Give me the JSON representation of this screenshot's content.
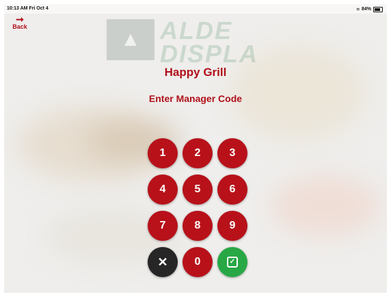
{
  "status_bar": {
    "time": "10:13 AM  Fri Oct 4",
    "battery": "84%",
    "icons": [
      "wifi-icon",
      "battery-icon"
    ]
  },
  "nav": {
    "back_label": "Back",
    "back_icon": "arrow-right-icon"
  },
  "watermark": {
    "line1": "ALDE",
    "line2": "DISPLA"
  },
  "header": {
    "title": "Happy Grill",
    "prompt": "Enter Manager Code"
  },
  "keypad": {
    "keys": [
      "1",
      "2",
      "3",
      "4",
      "5",
      "6",
      "7",
      "8",
      "9"
    ],
    "clear_icon": "close-icon",
    "clear_glyph": "✕",
    "zero": "0",
    "confirm_icon": "check-icon",
    "confirm_glyph": "✓"
  },
  "colors": {
    "brand_red": "#b8111a",
    "clear_dark": "#262626",
    "confirm_green": "#28a745"
  }
}
